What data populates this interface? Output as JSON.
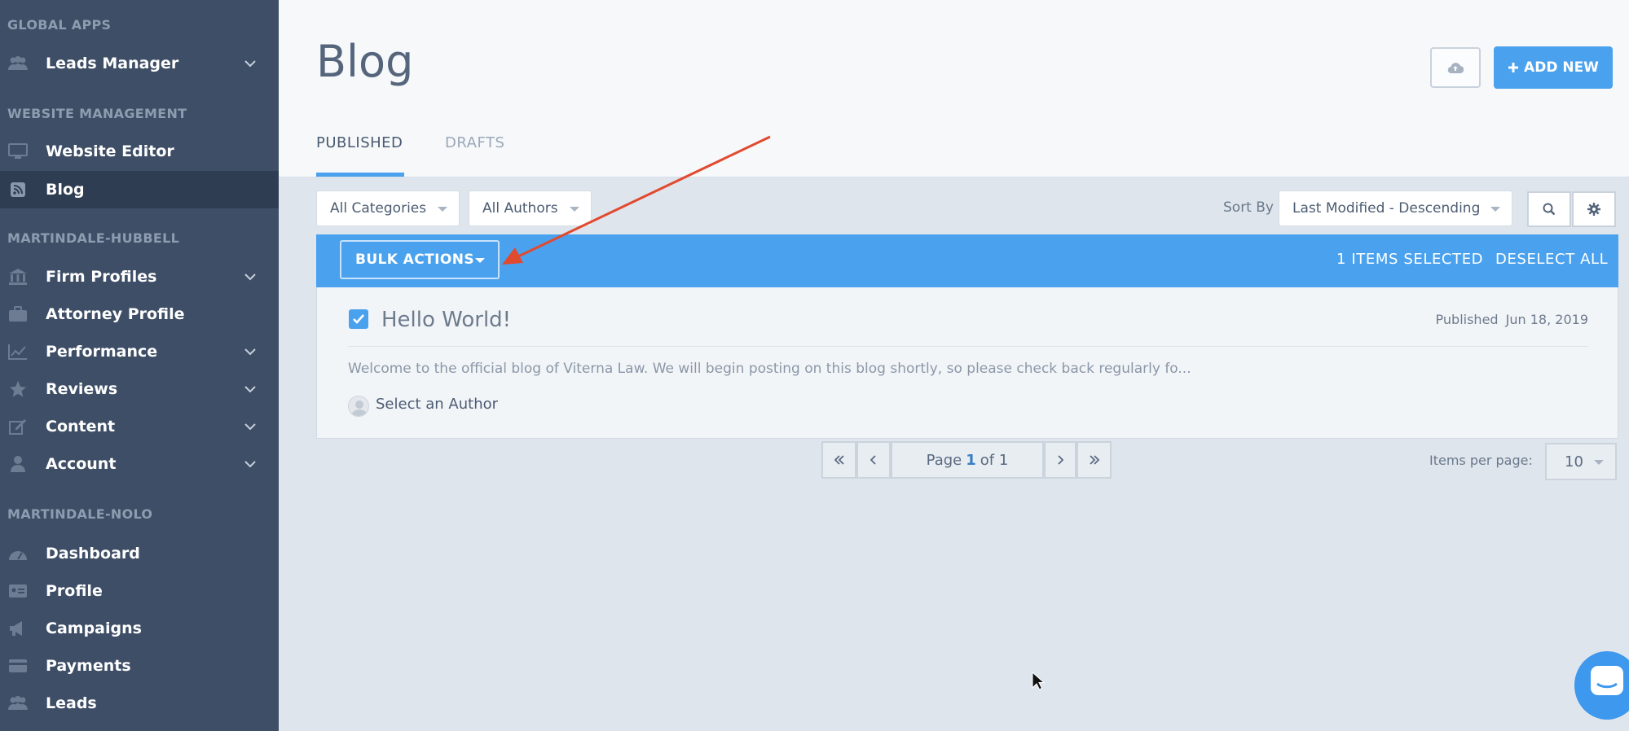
{
  "sidebar": {
    "sections": {
      "global_apps": "GLOBAL APPS",
      "website_management": "WEBSITE MANAGEMENT",
      "martindale_hubbell": "MARTINDALE-HUBBELL",
      "martindale_nolo": "MARTINDALE-NOLO"
    },
    "items": {
      "leads_manager": "Leads Manager",
      "website_editor": "Website Editor",
      "blog": "Blog",
      "firm_profiles": "Firm Profiles",
      "attorney_profile": "Attorney Profile",
      "performance": "Performance",
      "reviews": "Reviews",
      "content": "Content",
      "account": "Account",
      "dashboard": "Dashboard",
      "profile": "Profile",
      "campaigns": "Campaigns",
      "payments": "Payments",
      "leads": "Leads"
    }
  },
  "header": {
    "title": "Blog",
    "add_new_label": "ADD NEW",
    "tabs": {
      "published": "PUBLISHED",
      "drafts": "DRAFTS"
    }
  },
  "filters": {
    "categories": "All Categories",
    "authors": "All Authors",
    "sort_by_label": "Sort By",
    "sort_value": "Last Modified - Descending"
  },
  "bulk": {
    "label": "BULK ACTIONS",
    "selected": "1 ITEMS SELECTED",
    "deselect": "DESELECT ALL"
  },
  "post": {
    "title": "Hello World!",
    "status": "Published",
    "date": "Jun 18, 2019",
    "excerpt": "Welcome to the official blog of Viterna Law. We will begin posting on this blog shortly, so please check back regularly fo...",
    "author": "Select an Author"
  },
  "pagination": {
    "page_word": "Page",
    "current": "1",
    "of_total": "of 1",
    "items_per_page_label": "Items per page:",
    "items_per_page": "10"
  },
  "colors": {
    "accent": "#4aa1ee",
    "sidebar": "#3e4e66",
    "annotation": "#e14a2f"
  }
}
